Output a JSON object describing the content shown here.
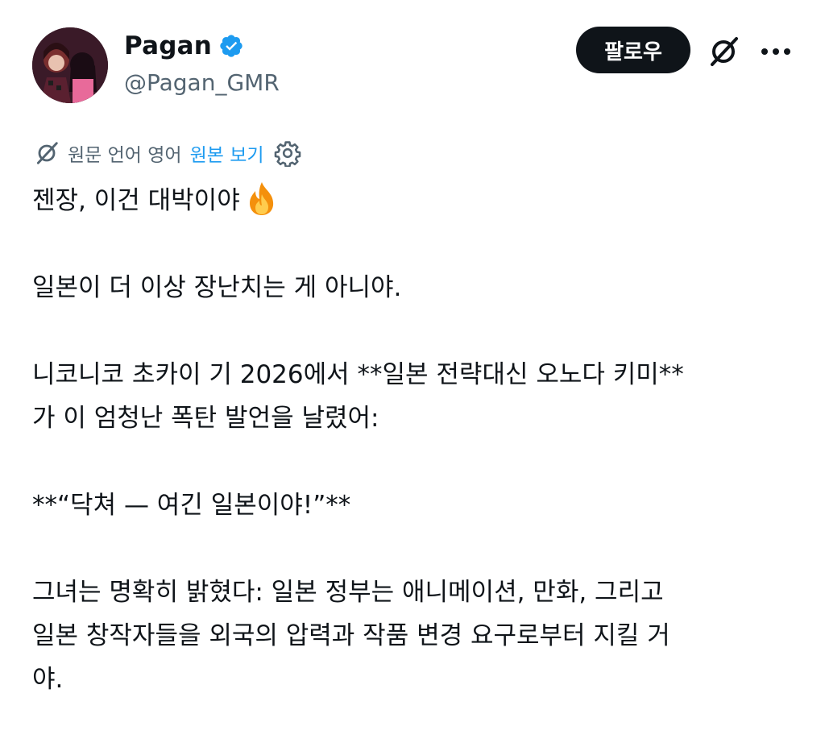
{
  "author": {
    "display_name": "Pagan",
    "handle": "@Pagan_GMR",
    "verified": true,
    "verified_color": "#1d9bf0"
  },
  "actions": {
    "follow_label": "팔로우",
    "grok_icon": "grok-icon",
    "more_icon": "more-icon"
  },
  "translation": {
    "label": "원문 언어 영어",
    "show_original_label": "원본 보기",
    "link_color": "#1d9bf0"
  },
  "tweet": {
    "line1": "젠장, 이건 대박이야",
    "line1_emoji": "fire",
    "line2": "일본이 더 이상 장난치는 게 아니야.",
    "line3a": "니코니코 초카이 기 2026에서 **일본 전략대신 오노다 키미**",
    "line3b": "가 이 엄청난 폭탄 발언을 날렸어:",
    "line4": "**“닥쳐 — 여긴 일본이야!”**",
    "line5a": "그녀는 명확히 밝혔다: 일본 정부는 애니메이션, 만화, 그리고",
    "line5b": "일본 창작자들을 외국의 압력과 작품 변경 요구로부터 지킬 거",
    "line5c": "야."
  }
}
